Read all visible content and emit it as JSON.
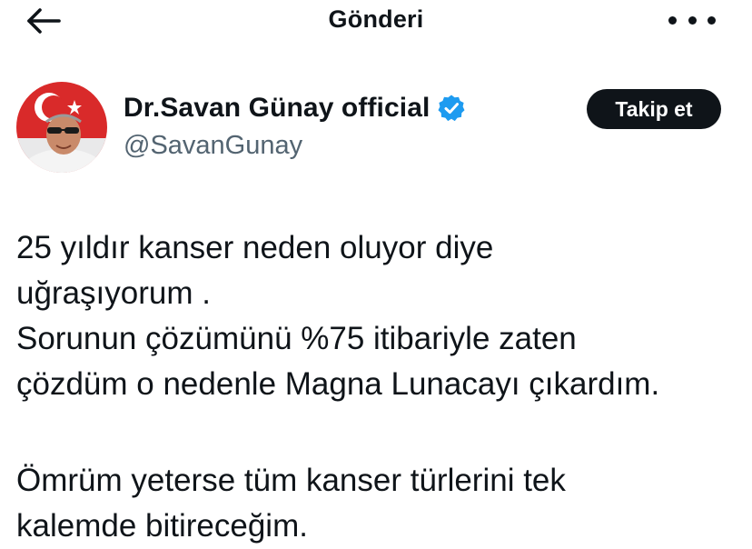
{
  "header": {
    "title": "Gönderi",
    "back_icon": "arrow-left-icon",
    "more_icon": "more-horizontal-icon"
  },
  "author": {
    "display_name": "Dr.Savan Günay official",
    "handle": "@SavanGunay",
    "verified_icon": "verified-badge-icon",
    "verified_color": "#1d9bf0"
  },
  "actions": {
    "follow_label": "Takip et"
  },
  "tweet": {
    "lines": [
      "25 yıldır kanser neden oluyor diye",
      "uğraşıyorum .",
      "Sorunun çözümünü %75 itibariyle zaten",
      "çözdüm o nedenle Magna Lunacayı çıkardım.",
      "",
      "Ömrüm yeterse tüm kanser türlerini tek",
      "kalemde bitireceğim."
    ]
  }
}
